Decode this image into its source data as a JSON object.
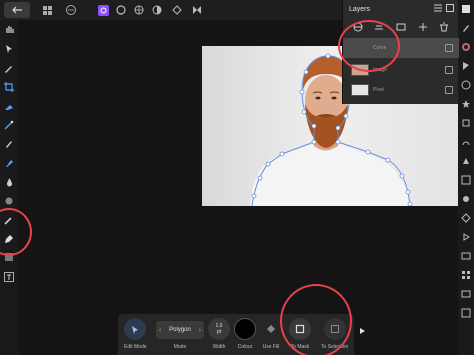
{
  "toolbar": {
    "icons": [
      "back-icon",
      "grid-icon",
      "more-icon",
      "pixel-persona-icon",
      "circle-icon",
      "mesh-icon",
      "export-icon",
      "develop-icon",
      "tone-icon"
    ]
  },
  "layers_panel": {
    "title": "Layers",
    "items": [
      {
        "name": "Curve",
        "selected": true
      },
      {
        "name": "Image",
        "selected": false
      },
      {
        "name": "Pixel",
        "selected": false
      }
    ]
  },
  "context_toolbar": {
    "edit_mode_label": "Edit Mode",
    "mode_value": "Polygon",
    "mode_label": "Mode",
    "width_value": "1.0",
    "width_unit": "pt",
    "width_label": "Width",
    "colour_label": "Colour",
    "use_fill_label": "Use Fill",
    "to_mask_label": "To Mask",
    "to_selection_label": "To Selection"
  },
  "colors": {
    "annotation": "#e6424d",
    "accent": "#8a52ff",
    "selection_node": "#6a8fd8"
  }
}
